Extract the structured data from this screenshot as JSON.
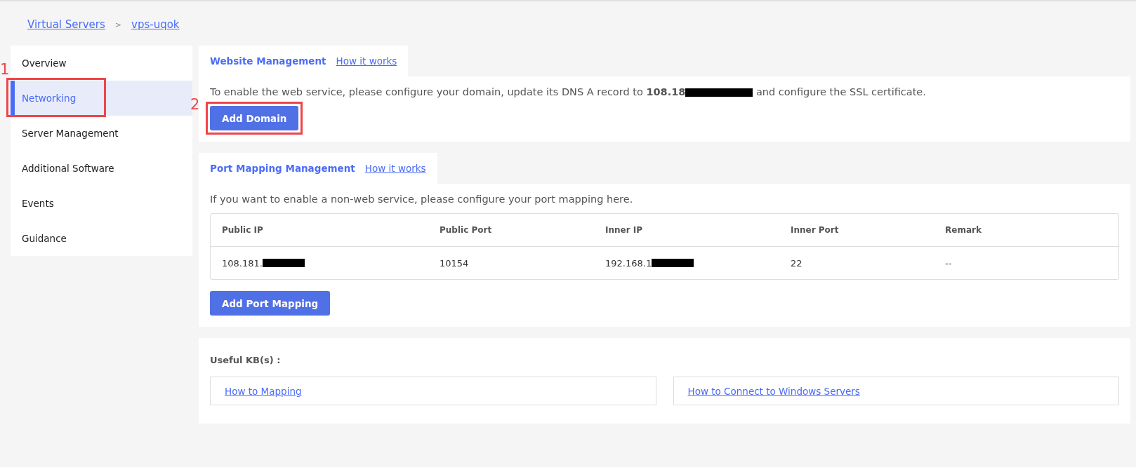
{
  "breadcrumb": [
    {
      "label": "Virtual Servers"
    },
    {
      "label": "vps-uqok"
    }
  ],
  "breadcrumb_separator": ">",
  "sidebar": {
    "items": [
      {
        "label": "Overview",
        "selected": false
      },
      {
        "label": "Networking",
        "selected": true,
        "callout": "1"
      },
      {
        "label": "Server Management",
        "selected": false
      },
      {
        "label": "Additional Software",
        "selected": false
      },
      {
        "label": "Events",
        "selected": false
      },
      {
        "label": "Guidance",
        "selected": false
      }
    ]
  },
  "website_management": {
    "title": "Website Management",
    "link": "How it works",
    "text_before": "To enable the web service, please configure your domain, update its DNS A record to ",
    "ip_visible": "108.18",
    "ip_redacted": true,
    "text_after": " and configure the SSL certificate.",
    "button": {
      "label": "Add Domain",
      "callout": "2"
    }
  },
  "port_mapping": {
    "title": "Port Mapping Management",
    "link": "How it works",
    "text": "If you want to enable a non-web service, please configure your port mapping here.",
    "table": {
      "columns": [
        "Public IP",
        "Public Port",
        "Inner IP",
        "Inner Port",
        "Remark"
      ],
      "rows": [
        [
          {
            "text": "108.181.",
            "redacted": true
          },
          {
            "text": "10154",
            "redacted": false
          },
          {
            "text": "192.168.1",
            "redacted": true
          },
          {
            "text": "22",
            "redacted": false
          },
          {
            "text": "--",
            "redacted": false
          }
        ]
      ]
    },
    "button": "Add Port Mapping"
  },
  "useful_kb": {
    "title": "Useful KB(s) :",
    "links": [
      "How to Mapping",
      "How to Connect to Windows Servers"
    ]
  }
}
